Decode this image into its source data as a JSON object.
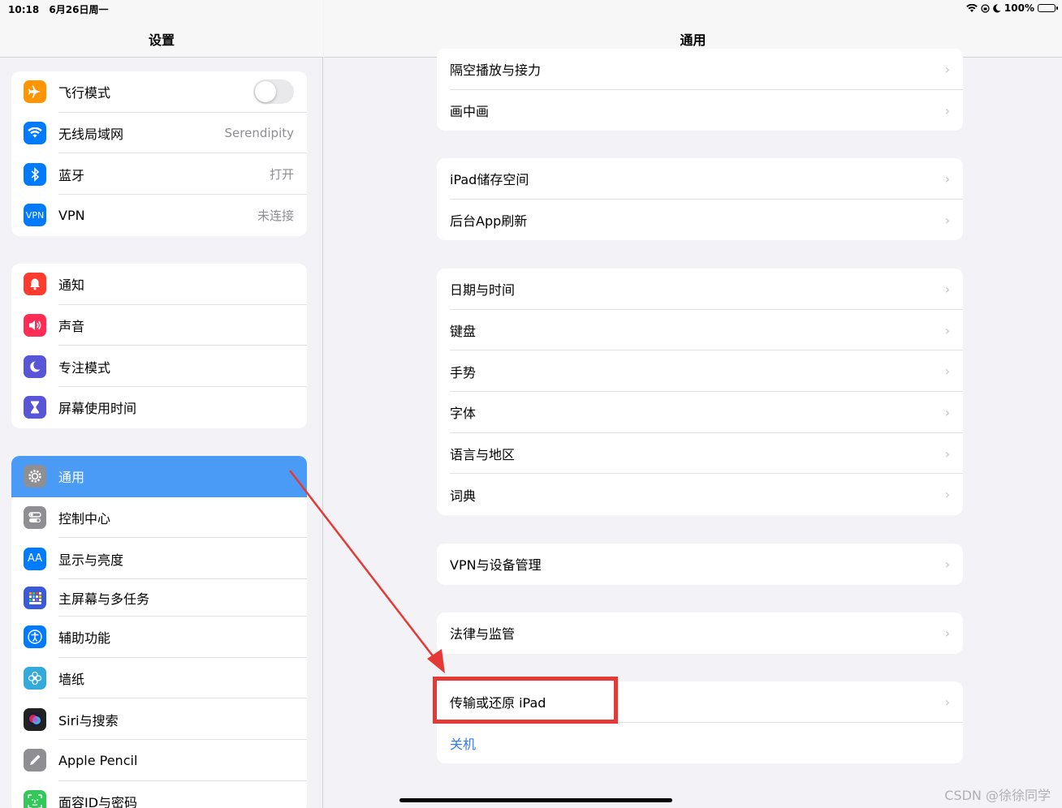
{
  "status_bar": {
    "time": "10:18",
    "date": "6月26日周一",
    "battery": "100%"
  },
  "sidebar": {
    "title": "设置",
    "groups": [
      {
        "items": [
          {
            "label": "飞行模式",
            "icon": "airplane-icon",
            "color": "#ff9500",
            "toggle": false
          },
          {
            "label": "无线局域网",
            "icon": "wifi-icon",
            "color": "#007aff",
            "value": "Serendipity"
          },
          {
            "label": "蓝牙",
            "icon": "bluetooth-icon",
            "color": "#007aff",
            "value": "打开"
          },
          {
            "label": "VPN",
            "icon": "vpn-icon",
            "color": "#007aff",
            "value": "未连接",
            "icon_text": "VPN"
          }
        ]
      },
      {
        "items": [
          {
            "label": "通知",
            "icon": "bell-icon",
            "color": "#ff3b30"
          },
          {
            "label": "声音",
            "icon": "speaker-icon",
            "color": "#ff2d55"
          },
          {
            "label": "专注模式",
            "icon": "moon-icon",
            "color": "#5856d6"
          },
          {
            "label": "屏幕使用时间",
            "icon": "hourglass-icon",
            "color": "#5856d6"
          }
        ]
      },
      {
        "items": [
          {
            "label": "通用",
            "icon": "gear-icon",
            "color": "#8e8e93",
            "selected": true
          },
          {
            "label": "控制中心",
            "icon": "switches-icon",
            "color": "#8e8e93"
          },
          {
            "label": "显示与亮度",
            "icon": "text-size-icon",
            "color": "#007aff",
            "icon_text": "AA"
          },
          {
            "label": "主屏幕与多任务",
            "icon": "grid-icon",
            "color": "#3a5bd9"
          },
          {
            "label": "辅助功能",
            "icon": "accessibility-icon",
            "color": "#007aff"
          },
          {
            "label": "墙纸",
            "icon": "flower-icon",
            "color": "#34aadc"
          },
          {
            "label": "Siri与搜索",
            "icon": "siri-icon",
            "color": "#222222"
          },
          {
            "label": "Apple Pencil",
            "icon": "pencil-icon",
            "color": "#8e8e93"
          },
          {
            "label": "面容ID与密码",
            "icon": "faceid-icon",
            "color": "#34c759"
          }
        ]
      }
    ]
  },
  "main": {
    "title": "通用",
    "groups": [
      {
        "items": [
          {
            "label": "隔空播放与接力"
          },
          {
            "label": "画中画"
          }
        ]
      },
      {
        "items": [
          {
            "label": "iPad储存空间"
          },
          {
            "label": "后台App刷新"
          }
        ]
      },
      {
        "items": [
          {
            "label": "日期与时间"
          },
          {
            "label": "键盘"
          },
          {
            "label": "手势"
          },
          {
            "label": "字体"
          },
          {
            "label": "语言与地区"
          },
          {
            "label": "词典"
          }
        ]
      },
      {
        "items": [
          {
            "label": "VPN与设备管理"
          }
        ]
      },
      {
        "items": [
          {
            "label": "法律与监管"
          }
        ]
      },
      {
        "items": [
          {
            "label": "传输或还原 iPad"
          },
          {
            "label": "关机",
            "blue": true
          }
        ]
      }
    ]
  },
  "watermark": "CSDN @徐徐同学",
  "colors": {
    "accent": "#007aff",
    "selected_row": "#4a9bf5",
    "annotation": "#e53935"
  }
}
